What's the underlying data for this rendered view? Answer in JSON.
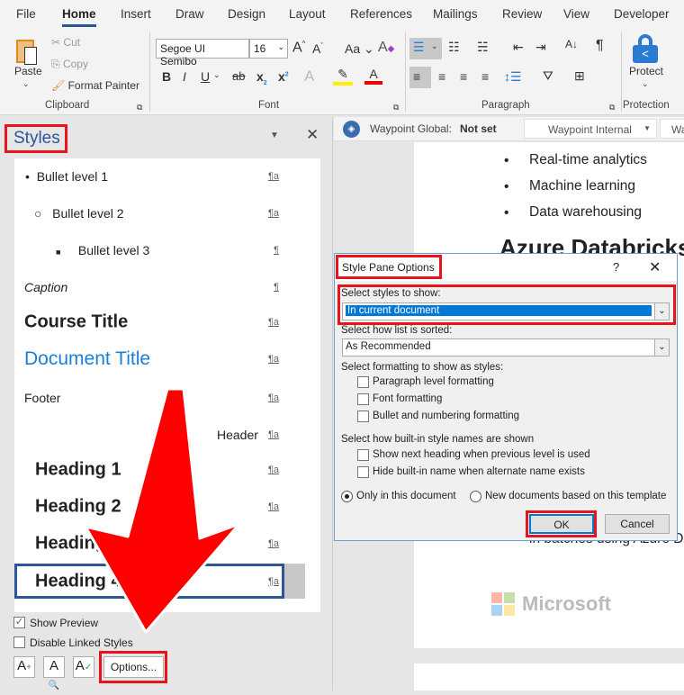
{
  "ribbon": {
    "tabs": [
      "File",
      "Home",
      "Insert",
      "Draw",
      "Design",
      "Layout",
      "References",
      "Mailings",
      "Review",
      "View",
      "Developer"
    ],
    "active_tab": "Home",
    "clipboard": {
      "paste": "Paste",
      "cut": "Cut",
      "copy": "Copy",
      "format_painter": "Format Painter",
      "group": "Clipboard"
    },
    "font": {
      "name": "Segoe UI Semibo",
      "size": "16",
      "group": "Font",
      "change_case": "Aa"
    },
    "paragraph": {
      "group": "Paragraph"
    },
    "protection": {
      "protect": "Protect",
      "group": "Protection"
    }
  },
  "styles_pane": {
    "title": "Styles",
    "items": [
      {
        "name": "Bullet level 1",
        "mark": "¶a"
      },
      {
        "name": "Bullet level 2",
        "mark": "¶a"
      },
      {
        "name": "Bullet level 3",
        "mark": "¶"
      },
      {
        "name": "Caption",
        "mark": "¶"
      },
      {
        "name": "Course Title",
        "mark": "¶a"
      },
      {
        "name": "Document Title",
        "mark": "¶a"
      },
      {
        "name": "Footer",
        "mark": "¶a"
      },
      {
        "name": "Header",
        "mark": "¶a"
      },
      {
        "name": "Heading 1",
        "mark": "¶a"
      },
      {
        "name": "Heading 2",
        "mark": "¶a"
      },
      {
        "name": "Heading 3",
        "mark": "¶a"
      },
      {
        "name": "Heading 4",
        "mark": "¶a"
      }
    ],
    "selected": "Heading 4",
    "show_preview": {
      "label": "Show Preview",
      "checked": true
    },
    "disable_linked": {
      "label": "Disable Linked Styles",
      "checked": false
    },
    "options_button": "Options..."
  },
  "waypoint": {
    "label": "Waypoint Global:",
    "value": "Not set",
    "dropdown": "Waypoint Internal",
    "dropdown2": "Wa"
  },
  "document": {
    "bullets": [
      "Real-time analytics",
      "Machine learning",
      "Data warehousing"
    ],
    "heading": "Azure Databricks",
    "partial_line": "in batches using Azure D",
    "watermark": "Microsoft"
  },
  "dialog": {
    "title": "Style Pane Options",
    "help": "?",
    "styles_label": "Select styles to show:",
    "styles_value": "In current document",
    "sort_label": "Select how list is sorted:",
    "sort_value": "As Recommended",
    "formatting_label": "Select formatting to show as styles:",
    "formatting": [
      {
        "label": "Paragraph level formatting",
        "checked": false
      },
      {
        "label": "Font formatting",
        "checked": false
      },
      {
        "label": "Bullet and numbering formatting",
        "checked": false
      }
    ],
    "names_label": "Select how built-in style names are shown",
    "names": [
      {
        "label": "Show next heading when previous level is used",
        "checked": false
      },
      {
        "label": "Hide built-in name when alternate name exists",
        "checked": false
      }
    ],
    "scope": [
      {
        "label": "Only in this document",
        "selected": true
      },
      {
        "label": "New documents based on this template",
        "selected": false
      }
    ],
    "ok": "OK",
    "cancel": "Cancel"
  },
  "colors": {
    "accent": "#2b579a",
    "highlight": "#e8141c",
    "doc_title": "#1a7fd4",
    "arrow": "#ff0000"
  }
}
